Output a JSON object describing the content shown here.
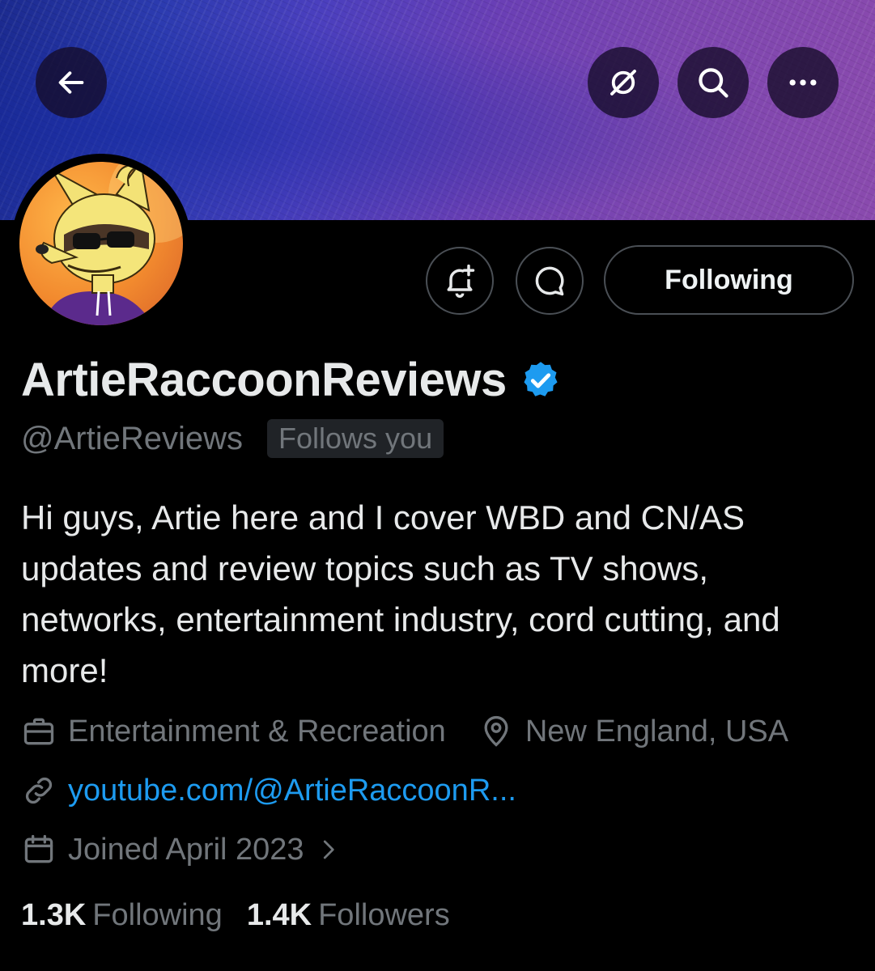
{
  "header": {
    "back_icon": "arrow-left-icon",
    "grok_icon": "grok-slash-icon",
    "search_icon": "search-icon",
    "more_icon": "more-horizontal-icon"
  },
  "profile": {
    "display_name": "ArtieRaccoonReviews",
    "verified": true,
    "handle": "@ArtieReviews",
    "follows_you": "Follows you",
    "bio": "Hi guys, Artie here and I cover WBD and CN/AS updates and review topics such as TV shows, networks, entertainment industry, cord cutting, and more!",
    "category": "Entertainment & Recreation",
    "location": "New England, USA",
    "website": "youtube.com/@ArtieRaccoonR...",
    "joined": "Joined April 2023"
  },
  "actions": {
    "notify_icon": "bell-plus-icon",
    "message_icon": "chat-bubble-icon",
    "following_label": "Following"
  },
  "stats": {
    "following_count": "1.3K",
    "following_label": "Following",
    "followers_count": "1.4K",
    "followers_label": "Followers"
  },
  "colors": {
    "background": "#000000",
    "accent": "#1d9bf0",
    "muted_text": "#71767b",
    "verified": "#1d9bf0"
  }
}
